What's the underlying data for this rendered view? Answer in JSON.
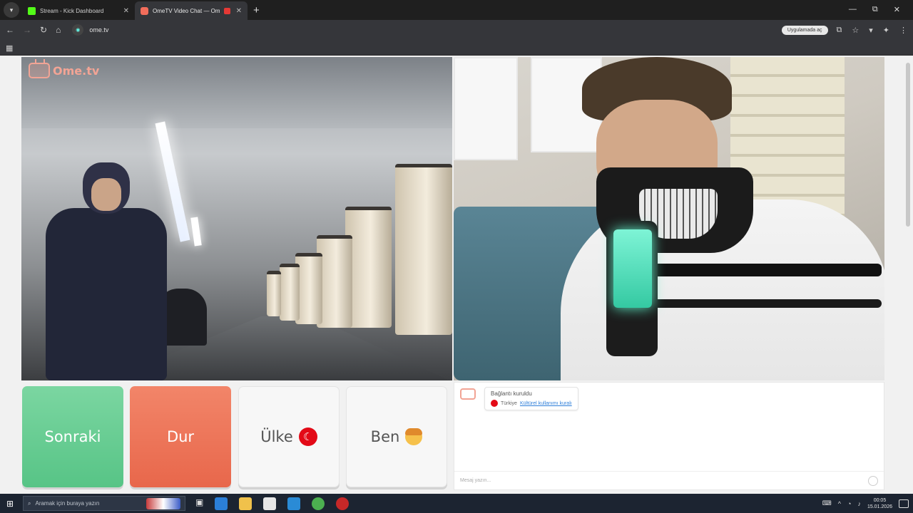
{
  "browser": {
    "tabs": [
      {
        "title": "Stream - Kick Dashboard",
        "active": false
      },
      {
        "title": "OmeTV Video Chat — Ome",
        "active": true
      }
    ],
    "new_tab": "+",
    "window_controls": [
      "—",
      "⧉",
      "✕"
    ],
    "url": "ome.tv",
    "open_in_app": "Uygulamada aç"
  },
  "ometv": {
    "logo_text": "Ome.tv",
    "buttons": {
      "next": "Sonraki",
      "stop": "Dur",
      "country": "Ülke",
      "me": "Ben"
    },
    "chat": {
      "status": "Bağlantı kuruldu",
      "country_name": "Türkiye",
      "country_link": "Kültürel kullanımı kuralı",
      "input_placeholder": "Mesaj yazın..."
    }
  },
  "taskbar": {
    "search_placeholder": "Aramak için buraya yazın",
    "clock_time": "00:05",
    "clock_date": "15.01.2026"
  },
  "colors": {
    "next_button": "#57c486",
    "stop_button": "#e8674b",
    "ome_brand": "#f2a495",
    "turkey_flag": "#e30a17"
  }
}
